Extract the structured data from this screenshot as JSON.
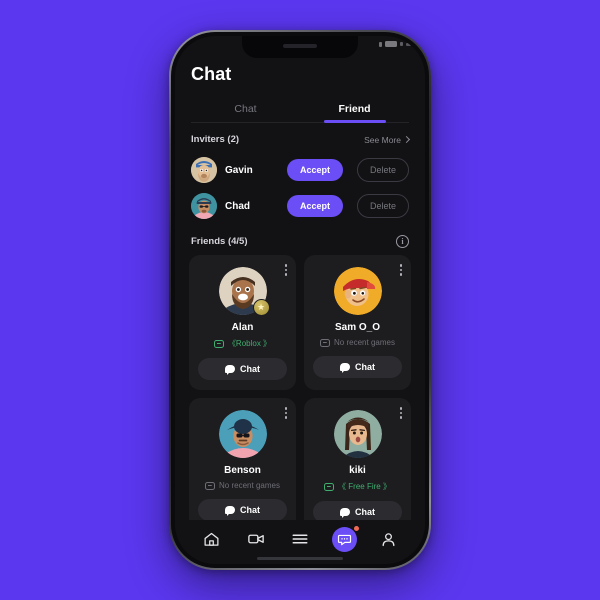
{
  "theme": {
    "page_background": "#5B37EF",
    "accent": "#6B4EF5",
    "screen_background": "#121214",
    "card_background": "#1d1d20",
    "playing_status_color": "#3fae6e",
    "idle_status_color": "#6e6e76",
    "badge_color": "#ef6a56"
  },
  "header": {
    "title": "Chat"
  },
  "tabs": [
    {
      "label": "Chat",
      "active": false
    },
    {
      "label": "Friend",
      "active": true
    }
  ],
  "inviters_section": {
    "title": "Inviters (2)",
    "see_more_label": "See More",
    "see_more_icon": "chevron-right-icon",
    "accept_label": "Accept",
    "delete_label": "Delete",
    "items": [
      {
        "name": "Gavin",
        "avatar_icon": "avatar-gavin"
      },
      {
        "name": "Chad",
        "avatar_icon": "avatar-chad"
      }
    ]
  },
  "friends_section": {
    "title": "Friends (4/5)",
    "info_icon": "info-icon",
    "info_glyph": "i",
    "chat_label": "Chat",
    "chat_icon": "chat-bubble-icon",
    "kebab_icon": "more-vertical-icon",
    "status_icon": "gamepad-icon",
    "cards": [
      {
        "name": "Alan",
        "avatar_icon": "avatar-alan",
        "status_text": "《Roblox 》",
        "status_type": "playing",
        "has_star_badge": true,
        "star_glyph": "★"
      },
      {
        "name": "Sam O_O",
        "avatar_icon": "avatar-sam",
        "status_text": "No recent games",
        "status_type": "idle",
        "has_star_badge": false,
        "star_glyph": ""
      },
      {
        "name": "Benson",
        "avatar_icon": "avatar-benson",
        "status_text": "No recent games",
        "status_type": "idle",
        "has_star_badge": false,
        "star_glyph": ""
      },
      {
        "name": "kiki",
        "avatar_icon": "avatar-kiki",
        "status_text": "《 Free Fire 》",
        "status_type": "playing",
        "has_star_badge": false,
        "star_glyph": ""
      }
    ]
  },
  "bottom_nav": [
    {
      "icon": "home-icon",
      "active": false,
      "badge": false
    },
    {
      "icon": "video-camera-icon",
      "active": false,
      "badge": false
    },
    {
      "icon": "menu-icon",
      "active": false,
      "badge": false
    },
    {
      "icon": "chat-bubble-dots-icon",
      "active": true,
      "badge": true
    },
    {
      "icon": "person-icon",
      "active": false,
      "badge": false
    }
  ]
}
